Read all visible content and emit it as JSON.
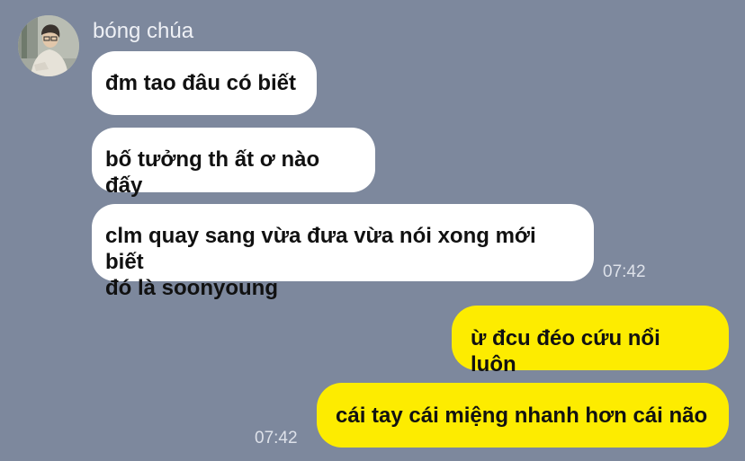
{
  "chat": {
    "sender_name": "bóng chúa",
    "incoming": [
      {
        "text": "đm tao đâu có biết"
      },
      {
        "text": "bố tưởng th ất ơ nào đấy"
      },
      {
        "text": "clm quay sang vừa đưa vừa nói xong mới biết\nđó là soonyoung"
      }
    ],
    "incoming_time": "07:42",
    "outgoing": [
      {
        "text": "ừ đcu đéo cứu nổi luôn"
      },
      {
        "text": "cái tay cái miệng nhanh hơn cái não"
      }
    ],
    "outgoing_time": "07:42"
  },
  "colors": {
    "background": "#7d889d",
    "incoming_bubble": "#ffffff",
    "outgoing_bubble": "#fdec00",
    "timestamp": "#dde1e9"
  }
}
